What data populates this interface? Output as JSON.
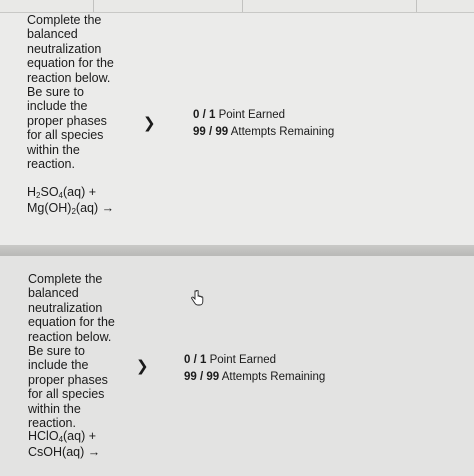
{
  "questions": [
    {
      "prompt": "Complete the\nbalanced\nneutralization\nequation for the\nreaction below.\nBe sure to\ninclude the\nproper phases\nfor all species\nwithin the\nreaction.",
      "equation": {
        "line1_a": "H",
        "line1_sub1": "2",
        "line1_b": "SO",
        "line1_sub2": "4",
        "line1_c": "(aq) +",
        "line2_a": "Mg(OH)",
        "line2_sub1": "2",
        "line2_c": "(aq) →"
      },
      "points_fraction": "0 / 1",
      "points_text": " Point Earned",
      "attempts_fraction": "99 / 99",
      "attempts_text": " Attempts Remaining",
      "expand_icon": "chevron-right-icon"
    },
    {
      "prompt": "Complete the\nbalanced\nneutralization\nequation for the\nreaction below.\nBe sure to\ninclude the\nproper phases\nfor all species\nwithin the\nreaction.",
      "equation": {
        "line1_a": "HClO",
        "line1_sub1": "4",
        "line1_c": "(aq) +",
        "line2_a": "CsOH(aq) →"
      },
      "points_fraction": "0 / 1",
      "points_text": " Point Earned",
      "attempts_fraction": "99 / 99",
      "attempts_text": " Attempts Remaining",
      "expand_icon": "chevron-right-icon"
    }
  ],
  "cursor_icon": "hand-pointer-icon",
  "colors": {
    "card": "#ebebea",
    "card_alt": "#e3e3e2",
    "divider": "#c0c0be",
    "text": "#1b1b1b"
  }
}
